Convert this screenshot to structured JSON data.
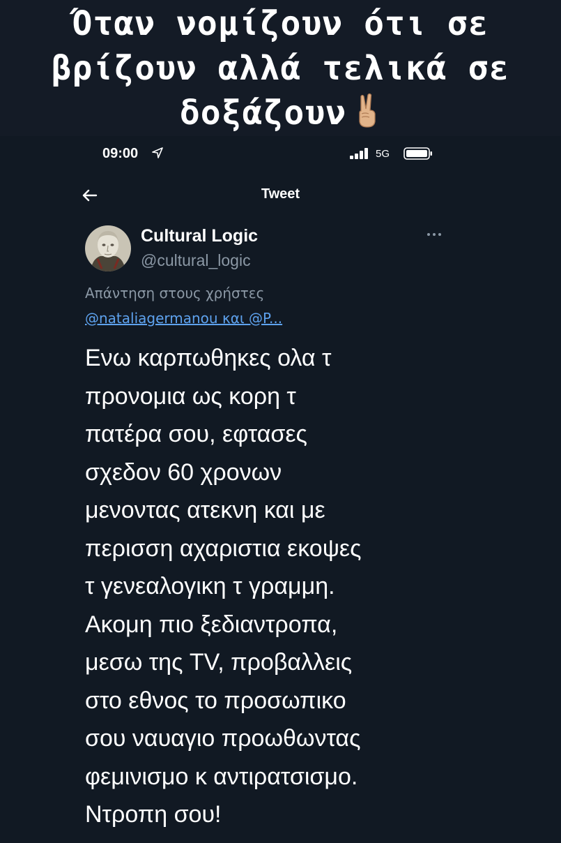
{
  "caption": {
    "lines": [
      "Όταν νομίζουν ότι σε",
      "βρίζουν αλλά τελικά σε",
      "δοξάζουν"
    ],
    "emoji": "victory-hand-emoji"
  },
  "status_bar": {
    "time": "09:00",
    "location_icon": "location-arrow-icon",
    "signal_icon": "cellular-signal-icon",
    "network": "5G",
    "battery_icon": "battery-icon"
  },
  "nav": {
    "back_icon": "back-arrow-icon",
    "title": "Tweet"
  },
  "tweet": {
    "author_name": "Cultural Logic",
    "author_handle": "@cultural_logic",
    "more_icon": "more-options-icon",
    "reply_to_label": "Απάντηση στους χρήστες",
    "reply_to_users": "@nataliagermanou και @P...",
    "text_lines": [
      "Ενω καρπωθηκες ολα τ",
      "προνομια ως κορη τ",
      "πατέρα σου, εφτασες",
      "σχεδον 60 χρονων",
      "μενοντας ατεκνη και με",
      "περισση αχαριστια εκοψες",
      "τ γενεαλογικη τ γραμμη.",
      "Ακομη πιο ξεδιαντροπα,",
      "μεσω της TV, προβαλλεις",
      "στο εθνος το προσωπικο",
      "σου ναυαγιο προωθωντας",
      "φεμινισμο κ αντιρατσισμο.",
      "Ντροπη σου!"
    ]
  },
  "colors": {
    "background": "#141b26",
    "text": "#ffffff",
    "secondary_text": "#8b98a5",
    "link": "#5ea2ee"
  }
}
